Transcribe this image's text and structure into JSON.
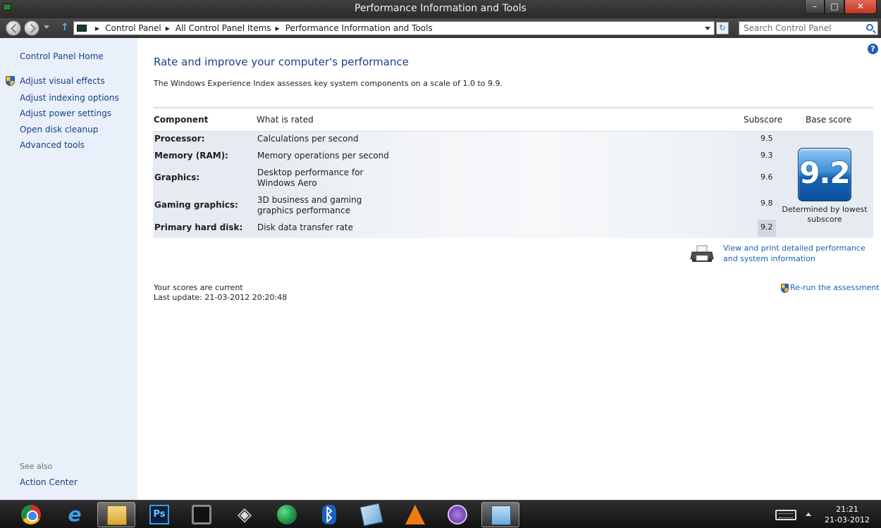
{
  "window": {
    "title": "Performance Information and Tools",
    "minimize_glyph": "–",
    "maximize_glyph": "□",
    "close_glyph": "✕"
  },
  "address_bar": {
    "breadcrumbs": [
      "Control Panel",
      "All Control Panel Items",
      "Performance Information and Tools"
    ],
    "up_glyph": "↑",
    "refresh_glyph": "↻",
    "search_placeholder": "Search Control Panel"
  },
  "left_pane": {
    "home_link": "Control Panel Home",
    "tasks": [
      "Adjust visual effects",
      "Adjust indexing options",
      "Adjust power settings",
      "Open disk cleanup",
      "Advanced tools"
    ],
    "see_also_label": "See also",
    "see_also_links": [
      "Action Center"
    ]
  },
  "main": {
    "help_glyph": "?",
    "title": "Rate and improve your computer's performance",
    "intro": "The Windows Experience Index assesses key system components on a scale of 1.0 to 9.9.",
    "table": {
      "headers": {
        "component": "Component",
        "what": "What is rated",
        "subscore": "Subscore",
        "base": "Base score"
      },
      "rows": [
        {
          "component": "Processor:",
          "what": "Calculations per second",
          "subscore": "9.5"
        },
        {
          "component": "Memory (RAM):",
          "what": "Memory operations per second",
          "subscore": "9.3"
        },
        {
          "component": "Graphics:",
          "what": "Desktop performance for Windows Aero",
          "subscore": "9.6"
        },
        {
          "component": "Gaming graphics:",
          "what": "3D business and gaming graphics performance",
          "subscore": "9.8"
        },
        {
          "component": "Primary hard disk:",
          "what": "Disk data transfer rate",
          "subscore": "9.2"
        }
      ],
      "base_score": "9.2",
      "base_caption": "Determined by lowest subscore"
    },
    "print_link": "View and print detailed performance and system information",
    "status_line1": "Your scores are current",
    "status_line2": "Last update: 21-03-2012 20:20:48",
    "rerun_link": "Re-run the assessment"
  },
  "taskbar": {
    "ps_label": "Ps",
    "bt_glyph": "ᛒ",
    "unity_glyph": "◈",
    "ie_glyph": "e",
    "clock_time": "21:21",
    "clock_date": "21-03-2012"
  },
  "colors": {
    "link": "#1a5fb4",
    "nav_link": "#1a3f83",
    "left_pane_bg": "#e9f0fa",
    "badge_blue": "#1665b8"
  }
}
